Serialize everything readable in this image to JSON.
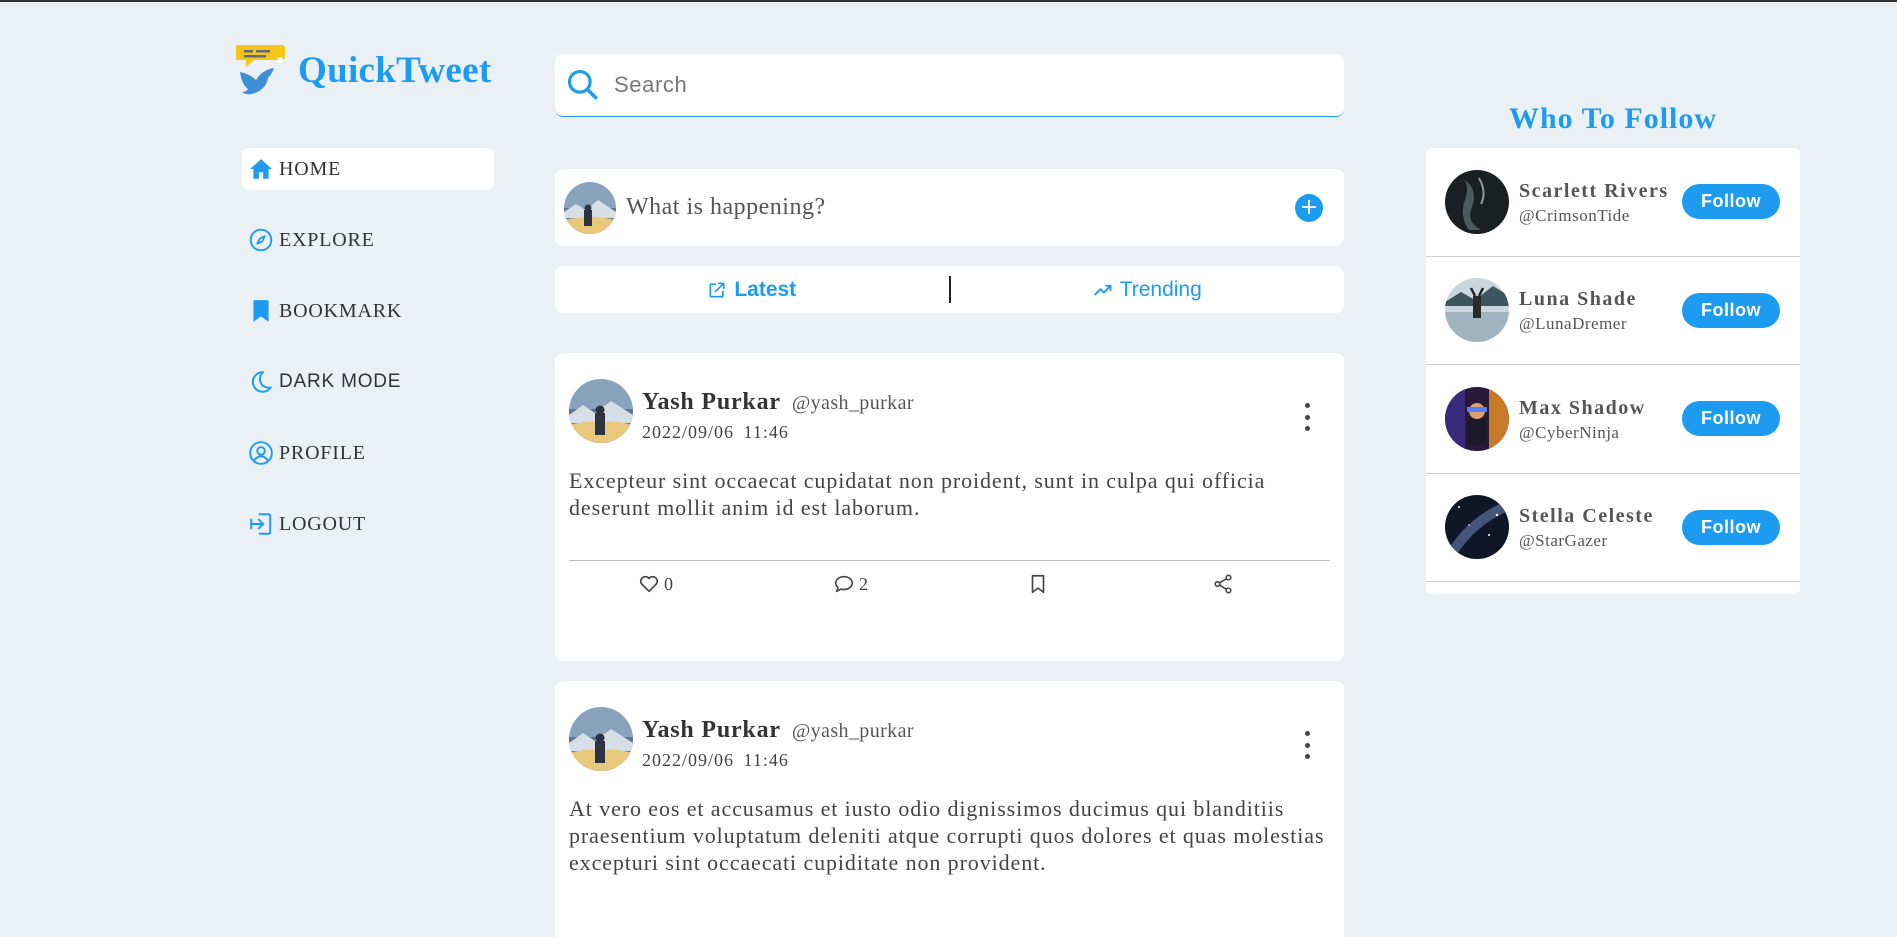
{
  "app": {
    "name": "QuickTweet"
  },
  "colors": {
    "accent": "#1d9bf0",
    "background": "#ebf0f5"
  },
  "nav": {
    "items": [
      {
        "label": "HOME",
        "icon": "home-icon",
        "active": true
      },
      {
        "label": "EXPLORE",
        "icon": "compass-icon"
      },
      {
        "label": "BOOKMARK",
        "icon": "bookmark-icon"
      },
      {
        "label": "DARK MODE",
        "icon": "moon-icon"
      },
      {
        "label": "PROFILE",
        "icon": "user-circle-icon"
      },
      {
        "label": "LOGOUT",
        "icon": "logout-icon"
      }
    ]
  },
  "search": {
    "placeholder": "Search",
    "icon": "search-icon"
  },
  "compose": {
    "placeholder": "What is happening?",
    "add_icon": "plus-circle-icon",
    "add_label": "+"
  },
  "tabs": [
    {
      "label": "Latest",
      "icon": "external-link-icon",
      "active": true
    },
    {
      "label": "Trending",
      "icon": "trending-up-icon"
    }
  ],
  "posts": [
    {
      "name": "Yash Purkar",
      "handle": "@yash_purkar",
      "date": "2022/09/06  11:46",
      "body": "Excepteur sint occaecat cupidatat non proident, sunt in culpa qui officia deserunt mollit anim id est laborum.",
      "likes": "0",
      "comments": "2"
    },
    {
      "name": "Yash Purkar",
      "handle": "@yash_purkar",
      "date": "2022/09/06  11:46",
      "body": "At vero eos et accusamus et iusto odio dignissimos ducimus qui blanditiis praesentium voluptatum deleniti atque corrupti quos dolores et quas molestias excepturi sint occaecati cupiditate non provident."
    }
  ],
  "who_to_follow": {
    "title": "Who To Follow",
    "users": [
      {
        "name": "Scarlett Rivers",
        "handle": "@CrimsonTide",
        "button": "Follow"
      },
      {
        "name": "Luna Shade",
        "handle": "@LunaDremer",
        "button": "Follow"
      },
      {
        "name": "Max Shadow",
        "handle": "@CyberNinja",
        "button": "Follow"
      },
      {
        "name": "Stella Celeste",
        "handle": "@StarGazer",
        "button": "Follow"
      }
    ]
  }
}
